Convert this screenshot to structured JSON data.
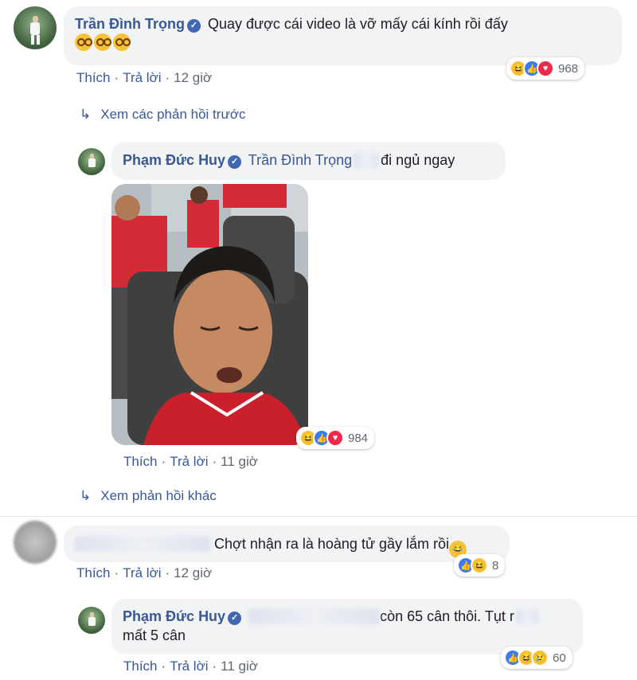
{
  "comments": [
    {
      "author": "Trần Đình Trọng",
      "text": "Quay được cái video là vỡ mấy cái kính rồi đấy",
      "emoji": [
        "nerd-face",
        "nerd-face",
        "nerd-face"
      ],
      "actions": {
        "like": "Thích",
        "reply": "Trả lời",
        "time": "12 giờ"
      },
      "reactions": {
        "icons": [
          "haha",
          "like",
          "love"
        ],
        "count": "968"
      }
    },
    {
      "author": "Phạm Đức Huy",
      "tag": "Trần Đình Trọng",
      "text": "đi ngủ ngay",
      "photo_desc": "sleeping-player-photo",
      "actions": {
        "like": "Thích",
        "reply": "Trả lời",
        "time": "11 giờ"
      },
      "reactions": {
        "icons": [
          "haha",
          "like",
          "love"
        ],
        "count": "984"
      }
    },
    {
      "text": "Chợt nhận ra là hoàng tử gầy lắm rồi",
      "actions": {
        "like": "Thích",
        "reply": "Trả lời",
        "time": "12 giờ"
      },
      "reactions": {
        "icons": [
          "like",
          "haha"
        ],
        "count": "8"
      }
    },
    {
      "author": "Phạm Đức Huy",
      "text_line1": "còn 65 cân thôi. Tụt r",
      "text_line2": "mất 5 cân",
      "actions": {
        "like": "Thích",
        "reply": "Trả lời",
        "time": "11 giờ"
      },
      "reactions": {
        "icons": [
          "like",
          "haha",
          "sad"
        ],
        "count": "60"
      }
    }
  ],
  "links": {
    "previous_replies": "Xem các phản hồi trước",
    "other_replies": "Xem phản hồi khác"
  },
  "colors": {
    "link": "#385898",
    "bubble": "#f2f3f5",
    "meta": "#606770"
  }
}
